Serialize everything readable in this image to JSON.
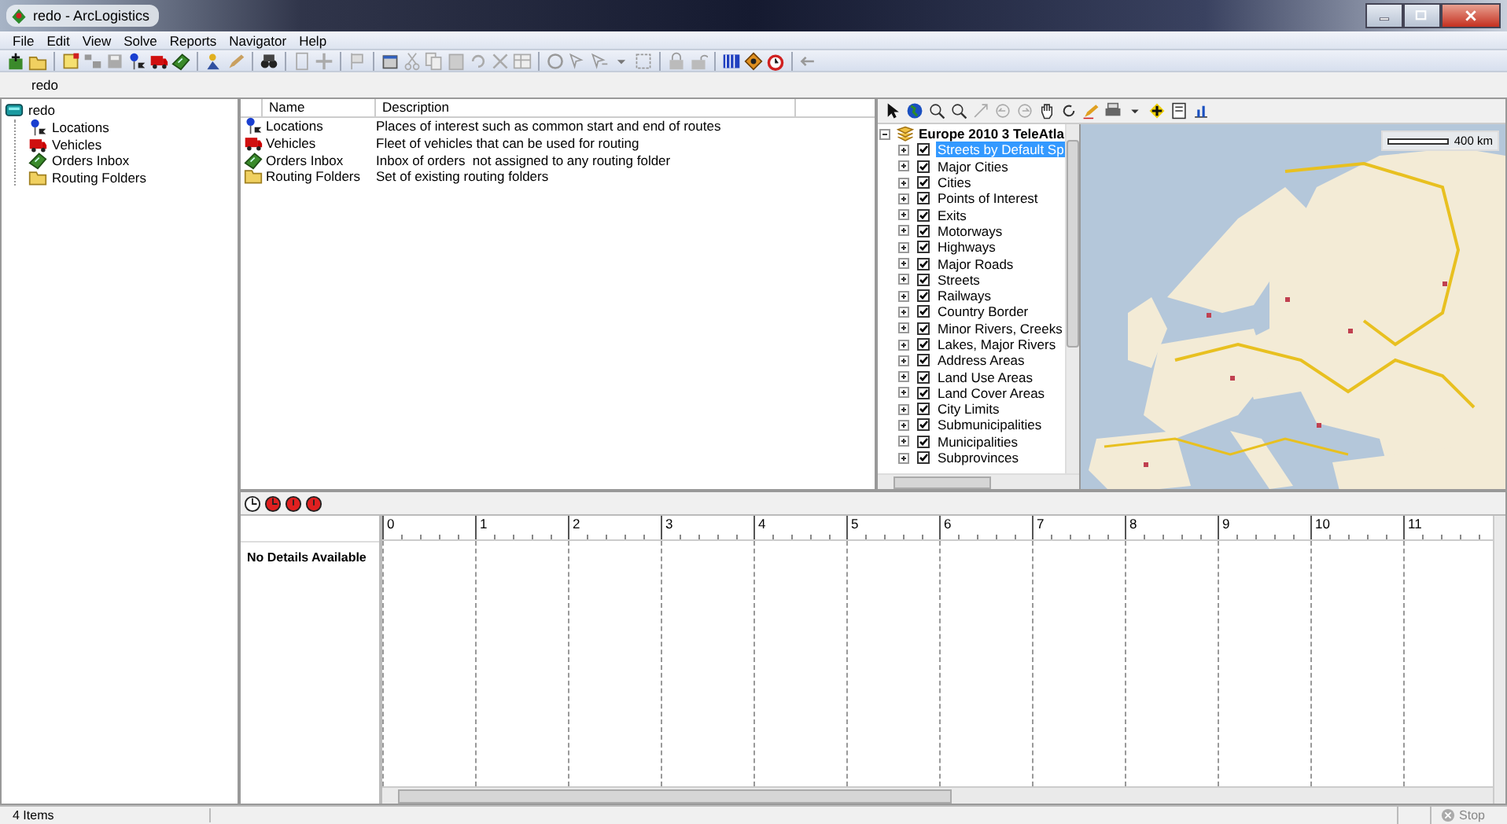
{
  "window": {
    "title": "redo - ArcLogistics"
  },
  "menu": [
    "File",
    "Edit",
    "View",
    "Solve",
    "Reports",
    "Navigator",
    "Help"
  ],
  "breadcrumb": "redo",
  "tree": {
    "label": "redo",
    "kind": "project",
    "children": [
      {
        "label": "Locations",
        "kind": "location"
      },
      {
        "label": "Vehicles",
        "kind": "vehicle"
      },
      {
        "label": "Orders Inbox",
        "kind": "orders"
      },
      {
        "label": "Routing Folders",
        "kind": "folder"
      }
    ]
  },
  "list": {
    "columns": [
      "Name",
      "Description"
    ],
    "rows": [
      {
        "kind": "location",
        "name": "Locations",
        "description": "Places of interest such as common start and end of routes"
      },
      {
        "kind": "vehicle",
        "name": "Vehicles",
        "description": "Fleet of vehicles that can be used for routing"
      },
      {
        "kind": "orders",
        "name": "Orders Inbox",
        "description": "Inbox of orders  not assigned to any routing folder"
      },
      {
        "kind": "folder",
        "name": "Routing Folders",
        "description": "Set of existing routing folders"
      }
    ]
  },
  "map": {
    "layer_group": "Europe 2010 3 TeleAtla",
    "scale": "400 km",
    "layers": [
      {
        "label": "Streets by Default Sp",
        "checked": true,
        "selected": true
      },
      {
        "label": "Major Cities",
        "checked": true,
        "selected": false
      },
      {
        "label": "Cities",
        "checked": true,
        "selected": false
      },
      {
        "label": "Points of Interest",
        "checked": true,
        "selected": false
      },
      {
        "label": "Exits",
        "checked": true,
        "selected": false
      },
      {
        "label": "Motorways",
        "checked": true,
        "selected": false
      },
      {
        "label": "Highways",
        "checked": true,
        "selected": false
      },
      {
        "label": "Major Roads",
        "checked": true,
        "selected": false
      },
      {
        "label": "Streets",
        "checked": true,
        "selected": false
      },
      {
        "label": "Railways",
        "checked": true,
        "selected": false
      },
      {
        "label": "Country Border",
        "checked": true,
        "selected": false
      },
      {
        "label": "Minor Rivers, Creeks",
        "checked": true,
        "selected": false
      },
      {
        "label": "Lakes, Major Rivers",
        "checked": true,
        "selected": false
      },
      {
        "label": "Address Areas",
        "checked": true,
        "selected": false
      },
      {
        "label": "Land Use Areas",
        "checked": true,
        "selected": false
      },
      {
        "label": "Land Cover Areas",
        "checked": true,
        "selected": false
      },
      {
        "label": "City Limits",
        "checked": true,
        "selected": false
      },
      {
        "label": "Submunicipalities",
        "checked": true,
        "selected": false
      },
      {
        "label": "Municipalities",
        "checked": true,
        "selected": false
      },
      {
        "label": "Subprovinces",
        "checked": true,
        "selected": false
      }
    ]
  },
  "schedule": {
    "message": "No Details Available",
    "ticks": [
      "0",
      "1",
      "2",
      "3",
      "4",
      "5",
      "6",
      "7",
      "8",
      "9",
      "10",
      "11"
    ]
  },
  "status_bar": {
    "items": "4 Items",
    "stop": "Stop"
  }
}
